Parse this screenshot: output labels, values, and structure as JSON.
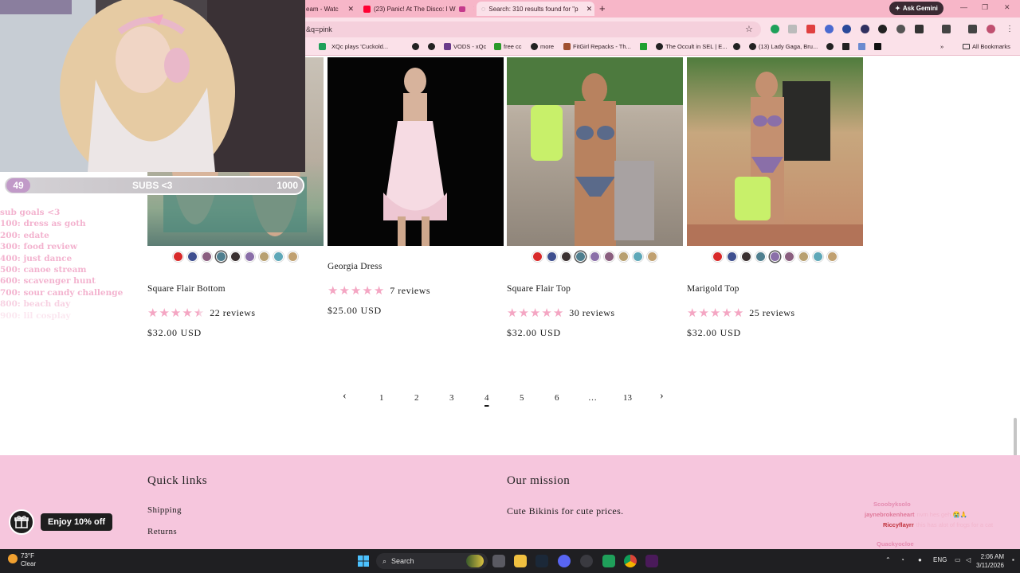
{
  "browser": {
    "tabs": [
      {
        "title": "eam - Watc",
        "icon_color": "#9146ff"
      },
      {
        "title": "(23) Panic! At The Disco: I W",
        "icon_color": "#ff0033"
      },
      {
        "title": "Search: 310 results found for \"p",
        "icon_color": "#888888",
        "active": true
      }
    ],
    "ask_gemini": "Ask Gemini",
    "url": "&q=pink",
    "bookmarks": [
      "XQc plays 'Cuckold...",
      "VODS - xQc",
      "free cc",
      "more",
      "FitGirl Repacks - Th...",
      "The Occult in SEL | E...",
      "(13) Lady Gaga, Bru..."
    ],
    "all_bookmarks": "All Bookmarks"
  },
  "products": [
    {
      "title": "Square Flair Bottom",
      "rating": 4.5,
      "reviews": "22 reviews",
      "price": "$32.00 USD",
      "swatches": [
        "#d82a2a",
        "#3f4f8f",
        "#8a5f7f",
        "#4f7f8f",
        "#3a3030",
        "#8a6fa8",
        "#b8a070",
        "#5fa8b8",
        "#c0a070"
      ],
      "selected_swatch": 3
    },
    {
      "title": "Georgia Dress",
      "rating": 5,
      "reviews": "7 reviews",
      "price": "$25.00 USD",
      "swatches": [],
      "selected_swatch": -1
    },
    {
      "title": "Square Flair Top",
      "rating": 5,
      "reviews": "30 reviews",
      "price": "$32.00 USD",
      "swatches": [
        "#d82a2a",
        "#3f4f8f",
        "#3a3030",
        "#4f7f8f",
        "#8a6fa8",
        "#8a5f7f",
        "#b8a070",
        "#5fa8b8",
        "#c0a070"
      ],
      "selected_swatch": 3
    },
    {
      "title": "Marigold Top",
      "rating": 5,
      "reviews": "25 reviews",
      "price": "$32.00 USD",
      "swatches": [
        "#d82a2a",
        "#3f4f8f",
        "#3a3030",
        "#4f7f8f",
        "#8a6fa8",
        "#8a5f7f",
        "#b8a070",
        "#5fa8b8",
        "#c0a070"
      ],
      "selected_swatch": 4
    }
  ],
  "pagination": {
    "prev": "‹",
    "pages": [
      "1",
      "2",
      "3",
      "4",
      "5",
      "6",
      "…",
      "13"
    ],
    "current": "4",
    "next": "›"
  },
  "footer": {
    "quick_links_title": "Quick links",
    "links": [
      "Shipping",
      "Returns"
    ],
    "mission_title": "Our mission",
    "mission_text": "Cute Bikinis for cute prices."
  },
  "promo": {
    "label": "Enjoy 10% off"
  },
  "stream": {
    "sub_count": "49",
    "sub_label": "SUBS <3",
    "sub_goal": "1000",
    "goals_title": "sub goals <3",
    "goals": [
      "100: dress as goth",
      "200: edate",
      "300: food review",
      "400: just dance",
      "500: canoe stream",
      "600: scavenger hunt",
      "700: sour candy challenge",
      "800: beach day",
      "900: lil cosplay"
    ],
    "chat": [
      {
        "user": "Scoobyksolo",
        "msg": "",
        "color": "#e58bb0"
      },
      {
        "user": "jaynebrokenheart",
        "msg": "nvm hes geh 😭🙏",
        "color": "#e07a9a"
      },
      {
        "user": "Riccyflayrr",
        "msg": "this has alot of frogs for a cat",
        "color": "#c0303a"
      },
      {
        "user": "Quackyocloe",
        "msg": "",
        "color": "#e58bb0"
      }
    ]
  },
  "taskbar": {
    "weather_temp": "73°F",
    "weather_desc": "Clear",
    "search": "Search",
    "lang": "ENG",
    "time": "2:06 AM",
    "date": "3/11/2026"
  }
}
